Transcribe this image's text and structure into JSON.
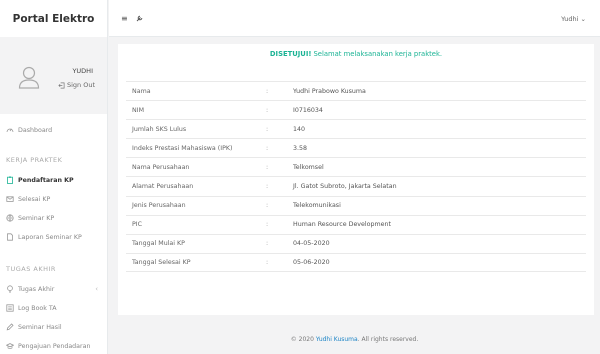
{
  "brand": "Portal Elektro",
  "profile": {
    "name": "YUDHI",
    "signout": "Sign Out"
  },
  "nav": {
    "dashboard": "Dashboard",
    "section_kp": "KERJA PRAKTEK",
    "kp_items": [
      "Pendaftaran KP",
      "Selesai KP",
      "Seminar KP",
      "Laporan Seminar KP"
    ],
    "section_ta": "TUGAS AKHIR",
    "ta_items": [
      "Tugas Akhir",
      "Log Book TA",
      "Seminar Hasil",
      "Pengajuan Pendadaran"
    ]
  },
  "topbar": {
    "user": "Yudhi"
  },
  "alert": {
    "strong": "DISETUJUI!",
    "text": "Selamat melaksanakan kerja praktek."
  },
  "table": {
    "separator": ":",
    "rows": [
      {
        "label": "Nama",
        "value": "Yudhi Prabowo Kusuma"
      },
      {
        "label": "NIM",
        "value": "I0716034"
      },
      {
        "label": "Jumlah SKS Lulus",
        "value": "140"
      },
      {
        "label": "Indeks Prestasi Mahasiswa (IPK)",
        "value": "3.58"
      },
      {
        "label": "Nama Perusahaan",
        "value": "Telkomsel"
      },
      {
        "label": "Alamat Perusahaan",
        "value": "Jl. Gatot Subroto, Jakarta Selatan"
      },
      {
        "label": "Jenis Perusahaan",
        "value": "Telekomunikasi"
      },
      {
        "label": "PIC",
        "value": "Human Resource Development"
      },
      {
        "label": "Tanggal Mulai KP",
        "value": "04-05-2020"
      },
      {
        "label": "Tanggal Selesai KP",
        "value": "05-06-2020"
      }
    ]
  },
  "footer": {
    "prefix": "© 2020",
    "link": "Yudhi Kusuma",
    "suffix": ". All rights reserved."
  },
  "colors": {
    "accent": "#1ab394",
    "link": "#1c84c6",
    "background": "#f3f3f4"
  }
}
